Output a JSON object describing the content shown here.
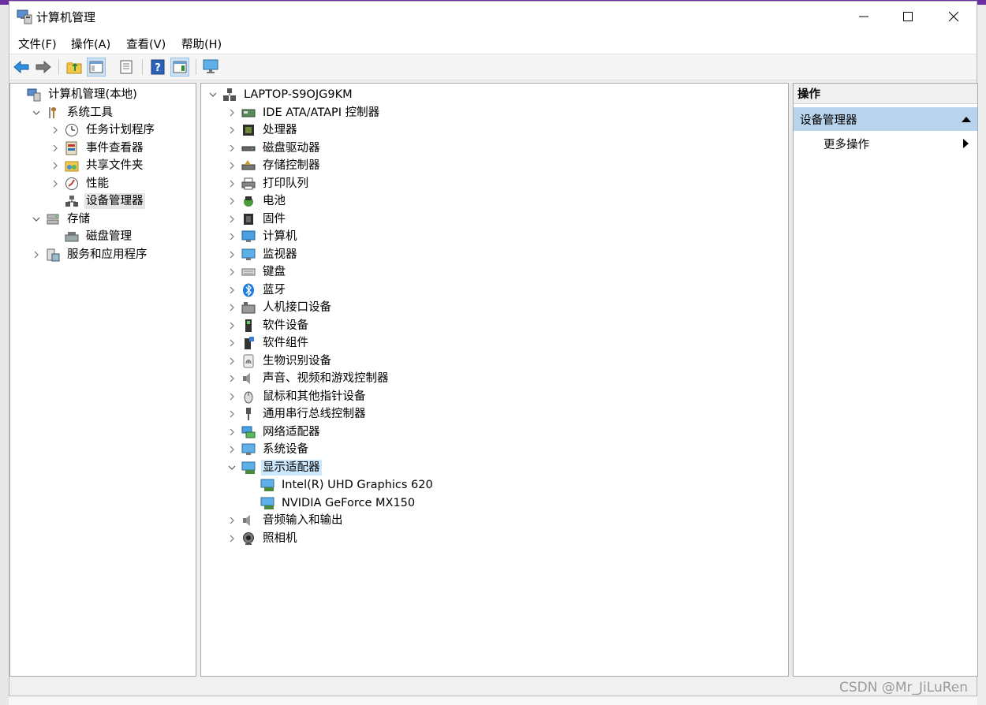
{
  "window": {
    "title": "计算机管理",
    "icon": "computer-management-icon"
  },
  "menu": [
    "文件(F)",
    "操作(A)",
    "查看(V)",
    "帮助(H)"
  ],
  "toolbar": [
    "back-arrow-icon",
    "forward-arrow-icon",
    "up-folder-icon",
    "show-hide-console-tree-icon",
    "properties-icon",
    "help-icon",
    "show-hide-action-pane-icon",
    "monitor-icon"
  ],
  "left_tree": [
    {
      "label": "计算机管理(本地)",
      "icon": "computer-management-icon",
      "chevron": "none"
    },
    {
      "label": "系统工具",
      "icon": "tools-icon",
      "chevron": "down"
    },
    {
      "label": "任务计划程序",
      "icon": "clock-icon",
      "chevron": "right"
    },
    {
      "label": "事件查看器",
      "icon": "event-viewer-icon",
      "chevron": "right"
    },
    {
      "label": "共享文件夹",
      "icon": "shared-folder-icon",
      "chevron": "right"
    },
    {
      "label": "性能",
      "icon": "performance-icon",
      "chevron": "right"
    },
    {
      "label": "设备管理器",
      "icon": "device-manager-icon",
      "chevron": "none",
      "selected": true
    },
    {
      "label": "存储",
      "icon": "storage-icon",
      "chevron": "down"
    },
    {
      "label": "磁盘管理",
      "icon": "disk-management-icon",
      "chevron": "none"
    },
    {
      "label": "服务和应用程序",
      "icon": "services-icon",
      "chevron": "right"
    }
  ],
  "device_tree": {
    "root": "LAPTOP-S9OJG9KM",
    "categories": [
      {
        "label": "IDE ATA/ATAPI 控制器",
        "icon": "ide-controller-icon"
      },
      {
        "label": "处理器",
        "icon": "processor-icon"
      },
      {
        "label": "磁盘驱动器",
        "icon": "disk-drive-icon"
      },
      {
        "label": "存储控制器",
        "icon": "storage-controller-icon"
      },
      {
        "label": "打印队列",
        "icon": "printer-icon"
      },
      {
        "label": "电池",
        "icon": "battery-icon"
      },
      {
        "label": "固件",
        "icon": "firmware-icon"
      },
      {
        "label": "计算机",
        "icon": "computer-icon"
      },
      {
        "label": "监视器",
        "icon": "monitor-icon"
      },
      {
        "label": "键盘",
        "icon": "keyboard-icon"
      },
      {
        "label": "蓝牙",
        "icon": "bluetooth-icon"
      },
      {
        "label": "人机接口设备",
        "icon": "hid-icon"
      },
      {
        "label": "软件设备",
        "icon": "software-device-icon"
      },
      {
        "label": "软件组件",
        "icon": "software-component-icon"
      },
      {
        "label": "生物识别设备",
        "icon": "fingerprint-icon"
      },
      {
        "label": "声音、视频和游戏控制器",
        "icon": "speaker-icon"
      },
      {
        "label": "鼠标和其他指针设备",
        "icon": "mouse-icon"
      },
      {
        "label": "通用串行总线控制器",
        "icon": "usb-icon"
      },
      {
        "label": "网络适配器",
        "icon": "network-adapter-icon"
      },
      {
        "label": "系统设备",
        "icon": "system-device-icon"
      },
      {
        "label": "显示适配器",
        "icon": "display-adapter-icon",
        "expanded": true,
        "children": [
          "Intel(R) UHD Graphics 620",
          "NVIDIA GeForce MX150"
        ]
      },
      {
        "label": "音频输入和输出",
        "icon": "audio-io-icon"
      },
      {
        "label": "照相机",
        "icon": "camera-icon"
      }
    ]
  },
  "actions": {
    "header": "操作",
    "section": "设备管理器",
    "item": "更多操作"
  },
  "watermark": "CSDN @Mr_JiLuRen"
}
